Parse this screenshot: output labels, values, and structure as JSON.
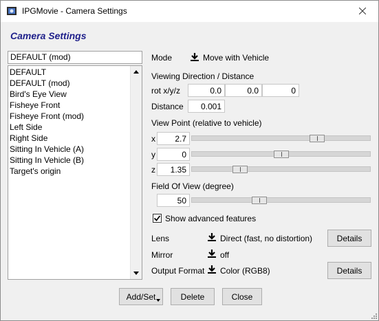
{
  "window": {
    "title": "IPGMovie - Camera Settings"
  },
  "heading": "Camera Settings",
  "preset": {
    "current": "DEFAULT (mod)",
    "items": [
      "DEFAULT",
      "DEFAULT (mod)",
      "Bird's Eye View",
      "Fisheye Front",
      "Fisheye Front (mod)",
      "Left Side",
      "Right Side",
      "Sitting In Vehicle (A)",
      "Sitting In Vehicle (B)",
      "Target's origin"
    ]
  },
  "mode": {
    "label": "Mode",
    "value": "Move with Vehicle"
  },
  "viewing": {
    "section_label": "Viewing Direction / Distance",
    "rot_label": "rot x/y/z",
    "rot_x": "0.0",
    "rot_y": "0.0",
    "rot_z": "0",
    "distance_label": "Distance",
    "distance": "0.001"
  },
  "viewpoint": {
    "section_label": "View Point (relative to vehicle)",
    "x_label": "x",
    "x_value": "2.7",
    "x_slider": 0.72,
    "y_label": "y",
    "y_value": "0",
    "y_slider": 0.5,
    "z_label": "z",
    "z_value": "1.35",
    "z_slider": 0.25
  },
  "fov": {
    "section_label": "Field Of View (degree)",
    "value": "50",
    "slider": 0.37
  },
  "advanced": {
    "label": "Show advanced features",
    "checked": true
  },
  "lens": {
    "label": "Lens",
    "value": "Direct (fast, no distortion)",
    "details": "Details"
  },
  "mirror": {
    "label": "Mirror",
    "value": "off"
  },
  "output": {
    "label": "Output Format",
    "value": "Color (RGB8)",
    "details": "Details"
  },
  "buttons": {
    "add_set": "Add/Set",
    "delete": "Delete",
    "close": "Close"
  },
  "colors": {
    "heading": "#1e1f8a",
    "window_bg": "#f0f0f0"
  },
  "icons": {
    "app": "camera-app-icon",
    "close": "close-icon",
    "dropdown": "download-arrow-icon",
    "scroll_up": "scroll-up-icon",
    "scroll_down": "scroll-down-icon"
  }
}
